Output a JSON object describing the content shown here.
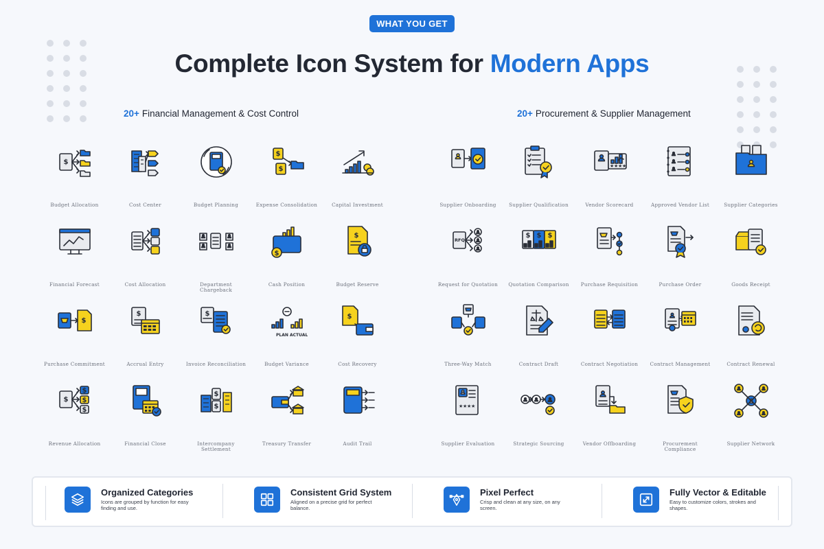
{
  "badge": "WHAT YOU GET",
  "title": {
    "main": "Complete Icon System for ",
    "accent": "Modern Apps"
  },
  "colors": {
    "accent": "#1f72d8",
    "yellow": "#f6d21e",
    "ink": "#2a2e37",
    "paper": "#e9ebef"
  },
  "sections": {
    "financial": {
      "count": "20+",
      "heading": "Financial Management & Cost Control",
      "icons": [
        {
          "label": "Budget Allocation",
          "icon": "document-to-folders-icon"
        },
        {
          "label": "Cost Center",
          "icon": "building-tags-icon"
        },
        {
          "label": "Budget Planning",
          "icon": "calculator-cycle-icon"
        },
        {
          "label": "Expense Consolidation",
          "icon": "receipts-folder-icon"
        },
        {
          "label": "Capital Investment",
          "icon": "bar-growth-coins-icon"
        },
        {
          "label": "Financial Forecast",
          "icon": "monitor-chart-icon"
        },
        {
          "label": "Cost Allocation",
          "icon": "receipt-split-icon"
        },
        {
          "label": "Department Chargeback",
          "icon": "users-receipt-icon"
        },
        {
          "label": "Cash Position",
          "icon": "wallet-chart-icon"
        },
        {
          "label": "Budget Reserve",
          "icon": "document-lock-icon"
        },
        {
          "label": "Purchase Commitment",
          "icon": "cart-documents-icon"
        },
        {
          "label": "Accrual Entry",
          "icon": "document-calendar-icon"
        },
        {
          "label": "Invoice Reconciliation",
          "icon": "invoice-check-icon"
        },
        {
          "label": "Budget Variance",
          "icon": "plan-actual-icon"
        },
        {
          "label": "Cost Recovery",
          "icon": "document-wallet-icon"
        },
        {
          "label": "Revenue Allocation",
          "icon": "document-to-dollars-icon"
        },
        {
          "label": "Financial Close",
          "icon": "ledger-calendar-icon"
        },
        {
          "label": "Intercompany Settlement",
          "icon": "buildings-transfer-icon"
        },
        {
          "label": "Treasury Transfer",
          "icon": "wallet-bank-icon"
        },
        {
          "label": "Audit Trail",
          "icon": "calculator-list-icon"
        }
      ]
    },
    "procurement": {
      "count": "20+",
      "heading": "Procurement & Supplier Management",
      "icons": [
        {
          "label": "Supplier Onboarding",
          "icon": "profile-to-check-icon"
        },
        {
          "label": "Supplier Qualification",
          "icon": "clipboard-badge-icon"
        },
        {
          "label": "Vendor Scorecard",
          "icon": "profile-scorecard-icon"
        },
        {
          "label": "Approved Vendor List",
          "icon": "checklist-notebook-icon"
        },
        {
          "label": "Supplier Categories",
          "icon": "folder-profile-icon"
        },
        {
          "label": "Request for Quotation",
          "icon": "rfq-users-icon"
        },
        {
          "label": "Quotation Comparison",
          "icon": "compare-sheets-icon"
        },
        {
          "label": "Purchase Requisition",
          "icon": "cart-approval-icon"
        },
        {
          "label": "Purchase Order",
          "icon": "order-badge-icon"
        },
        {
          "label": "Goods Receipt",
          "icon": "box-receipt-icon"
        },
        {
          "label": "Three-Way Match",
          "icon": "three-way-check-icon"
        },
        {
          "label": "Contract Draft",
          "icon": "contract-pen-icon"
        },
        {
          "label": "Contract Negotiation",
          "icon": "documents-exchange-icon"
        },
        {
          "label": "Contract Management",
          "icon": "contract-calendar-icon"
        },
        {
          "label": "Contract Renewal",
          "icon": "contract-renew-icon"
        },
        {
          "label": "Supplier Evaluation",
          "icon": "profile-stars-icon"
        },
        {
          "label": "Strategic Sourcing",
          "icon": "users-flow-icon"
        },
        {
          "label": "Vendor Offboarding",
          "icon": "profile-to-folder-icon"
        },
        {
          "label": "Procurement Compliance",
          "icon": "cart-shield-icon"
        },
        {
          "label": "Supplier Network",
          "icon": "network-icon"
        }
      ]
    }
  },
  "features": [
    {
      "title": "Organized Categories",
      "desc": "Icons are grouped by function for easy finding and use.",
      "icon": "layers-icon"
    },
    {
      "title": "Consistent Grid System",
      "desc": "Aligned on a precise grid for perfect balance.",
      "icon": "grid-icon"
    },
    {
      "title": "Pixel Perfect",
      "desc": "Crisp and clean at any size, on any screen.",
      "icon": "pen-tool-icon"
    },
    {
      "title": "Fully Vector & Editable",
      "desc": "Easy to customize colors, strokes and shapes.",
      "icon": "resize-icon"
    }
  ]
}
